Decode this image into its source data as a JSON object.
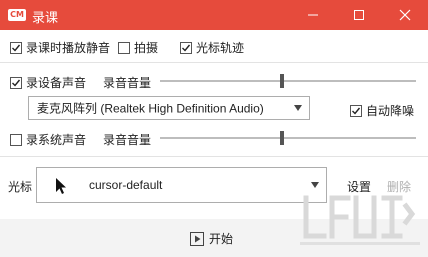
{
  "window": {
    "title": "录课",
    "app_icon_text": "CM"
  },
  "options": {
    "silent_record": {
      "label": "录课时播放静音",
      "checked": true
    },
    "photo": {
      "label": "拍摄",
      "checked": false
    },
    "cursor_track": {
      "label": "光标轨迹",
      "checked": true
    }
  },
  "device_audio": {
    "label": "录设备声音",
    "checked": true,
    "volume_label": "录音音量",
    "volume_fraction": 0.47,
    "device": "麦克风阵列 (Realtek High Definition Audio)",
    "noise_reduction": {
      "label": "自动降噪",
      "checked": true
    }
  },
  "system_audio": {
    "label": "录系统声音",
    "checked": false,
    "volume_label": "录音音量",
    "volume_fraction": 0.47
  },
  "cursor": {
    "label": "光标",
    "value": "cursor-default",
    "settings_label": "设置",
    "delete_label": "删除"
  },
  "footer": {
    "start_label": "开始"
  },
  "icons": {
    "minimize": "minimize-icon",
    "maximize": "maximize-icon",
    "close": "close-icon",
    "check": "check-icon",
    "dropdown": "chevron-down-icon",
    "cursor": "mouse-pointer-icon",
    "play": "play-icon"
  },
  "colors": {
    "titlebar": "#e64b3c",
    "disabled_text": "#b0b0b0"
  }
}
